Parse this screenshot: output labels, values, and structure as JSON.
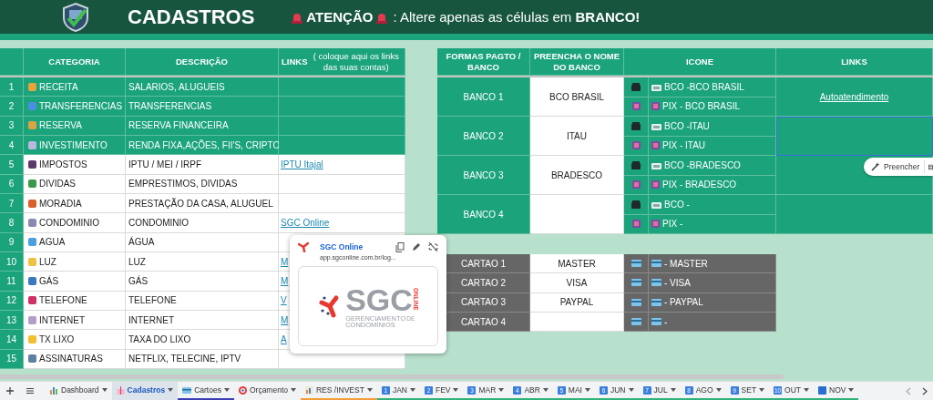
{
  "header": {
    "title": "CADASTROS",
    "alert_label": "ATENÇÃO",
    "alert_text": ": Altere apenas as células em **BRANCO!**"
  },
  "categories_table": {
    "columns": [
      "CATEGORIA",
      "DESCRIÇÃO",
      "**LINKS** ( coloque aqui os links das suas contas)"
    ],
    "rows": [
      {
        "number": "1",
        "category": "RECEITA",
        "description": "SALARIOS, ALUGUEIS",
        "kind": "featured",
        "color": "#e8a33a"
      },
      {
        "number": "2",
        "category": "TRANSFERENCIAS",
        "description": "TRANSFERENCIAS",
        "kind": "featured",
        "color": "#4a90e2"
      },
      {
        "number": "3",
        "category": "RESERVA",
        "description": "RESERVA FINANCEIRA",
        "kind": "featured",
        "color": "#d9a441"
      },
      {
        "number": "4",
        "category": "INVESTIMENTO",
        "description": "RENDA FIXA,AÇÕES, FII'S, CRIPTO",
        "kind": "featured",
        "color": "#b9b9e0"
      },
      {
        "number": "5",
        "category": "IMPOSTOS",
        "description": "IPTU / MEI / IRPF",
        "link": "IPTU Itajal",
        "kind": "plain",
        "color": "#5b3a6b"
      },
      {
        "number": "6",
        "category": "DIVIDAS",
        "description": "EMPRESTIMOS, DIVIDAS",
        "kind": "plain",
        "color": "#3a9a4a"
      },
      {
        "number": "7",
        "category": "MORADIA",
        "description": "PRESTAÇÃO DA CASA, ALUGUEL",
        "kind": "plain",
        "color": "#d9602b"
      },
      {
        "number": "8",
        "category": "CONDOMINIO",
        "description": "CONDOMINIO",
        "link": "SGC Online",
        "kind": "plain",
        "color": "#8a8ab0"
      },
      {
        "number": "9",
        "category": "AGUA",
        "description": "ÁGUA",
        "kind": "plain",
        "color": "#4aa0e0"
      },
      {
        "number": "10",
        "category": "LUZ",
        "description": "LUZ",
        "link": "M",
        "kind": "plain",
        "color": "#f0c040"
      },
      {
        "number": "11",
        "category": "GÁS",
        "description": "GÁS",
        "link": "M",
        "kind": "plain",
        "color": "#3a78c0"
      },
      {
        "number": "12",
        "category": "TELEFONE",
        "description": "TELEFONE",
        "link": "V",
        "kind": "plain",
        "color": "#d0306a"
      },
      {
        "number": "13",
        "category": "INTERNET",
        "description": "INTERNET",
        "link": "M",
        "kind": "plain",
        "color": "#b0a0c8"
      },
      {
        "number": "14",
        "category": "TX LIXO",
        "description": "TAXA DO LIXO",
        "link": "A",
        "kind": "plain",
        "color": "#f0c030"
      },
      {
        "number": "15",
        "category": "ASSINATURAS",
        "description": "NETFLIX, TELECINE, IPTV",
        "kind": "plain",
        "color": "#6080a0"
      }
    ]
  },
  "payments_table": {
    "columns": [
      "FORMAS PAGTO / BANCO",
      "PREENCHA O NOME DO BANCO",
      "ICONE",
      "LINKS"
    ],
    "banks": [
      {
        "label": "BANCO 1",
        "name": "BCO BRASIL",
        "lines": [
          {
            "kind": "bank",
            "text": "BCO -BCO BRASIL"
          },
          {
            "kind": "pix",
            "text": "PIX - BCO BRASIL"
          }
        ],
        "link": "Autoatendimento",
        "selected": false
      },
      {
        "label": "BANCO 2",
        "name": "ITAU",
        "lines": [
          {
            "kind": "bank",
            "text": "BCO -ITAU"
          },
          {
            "kind": "pix",
            "text": "PIX - ITAU"
          }
        ],
        "selected": true
      },
      {
        "label": "BANCO 3",
        "name": "BRADESCO",
        "lines": [
          {
            "kind": "bank",
            "text": "BCO -BRADESCO"
          },
          {
            "kind": "pix",
            "text": "PIX - BRADESCO"
          }
        ],
        "selected": false
      },
      {
        "label": "BANCO 4",
        "lines": [
          {
            "kind": "bank",
            "text": "BCO -"
          },
          {
            "kind": "pix",
            "text": "PIX -"
          }
        ],
        "selected": false
      }
    ],
    "cards": [
      {
        "label": "CARTAO 1",
        "name": "MASTER",
        "text": "- MASTER"
      },
      {
        "label": "CARTAO 2",
        "name": "VISA",
        "text": "- VISA"
      },
      {
        "label": "CARTAO 3",
        "name": "PAYPAL",
        "text": "- PAYPAL"
      },
      {
        "label": "CARTAO 4",
        "text": "-"
      }
    ]
  },
  "link_popup": {
    "title": "SGC Online",
    "url": "app.sgconline.com.br/log...",
    "preview": {
      "brand": "SGC",
      "tag": "ONLINE",
      "line_1": "GERENCIAMENTO",
      "line_1_small": "DE",
      "line_2": "CONDOMÍNIOS"
    }
  },
  "fill_chip": {
    "label": "Preencher"
  },
  "sheet_tabs": [
    {
      "label": "Dashboard",
      "kind": "chart",
      "selected": false
    },
    {
      "label": "Cadastros",
      "kind": "gift",
      "selected": true
    },
    {
      "label": "Cartoes",
      "kind": "card",
      "selected": false,
      "color": "#3d3db5"
    },
    {
      "label": "Orçamento",
      "kind": "target",
      "selected": false
    },
    {
      "label": "RES /INVEST",
      "kind": "bars",
      "selected": false,
      "color": "#f29d38"
    },
    {
      "label": "JAN",
      "kind": "number",
      "badge": "1",
      "selected": false,
      "color": "#2fb37a"
    },
    {
      "label": "FEV",
      "kind": "number",
      "badge": "2",
      "selected": false,
      "color": "#2fb37a"
    },
    {
      "label": "MAR",
      "kind": "number",
      "badge": "3",
      "selected": false,
      "color": "#2fb37a"
    },
    {
      "label": "ABR",
      "kind": "number",
      "badge": "4",
      "selected": false,
      "color": "#2fb37a"
    },
    {
      "label": "MAI",
      "kind": "number",
      "badge": "5",
      "selected": false,
      "color": "#2fb37a"
    },
    {
      "label": "JUN",
      "kind": "number",
      "badge": "6",
      "selected": false,
      "color": "#2fb37a"
    },
    {
      "label": "JUL",
      "kind": "number",
      "badge": "7",
      "selected": false,
      "color": "#2fb37a"
    },
    {
      "label": "AGO",
      "kind": "number",
      "badge": "8",
      "selected": false,
      "color": "#2fb37a"
    },
    {
      "label": "SET",
      "kind": "number",
      "badge": "9",
      "selected": false,
      "color": "#2fb37a"
    },
    {
      "label": "OUT",
      "kind": "number",
      "badge": "10",
      "selected": false,
      "color": "#2fb37a"
    },
    {
      "label": "NOV",
      "kind": "square",
      "selected": false,
      "color": "#2fb37a"
    }
  ]
}
